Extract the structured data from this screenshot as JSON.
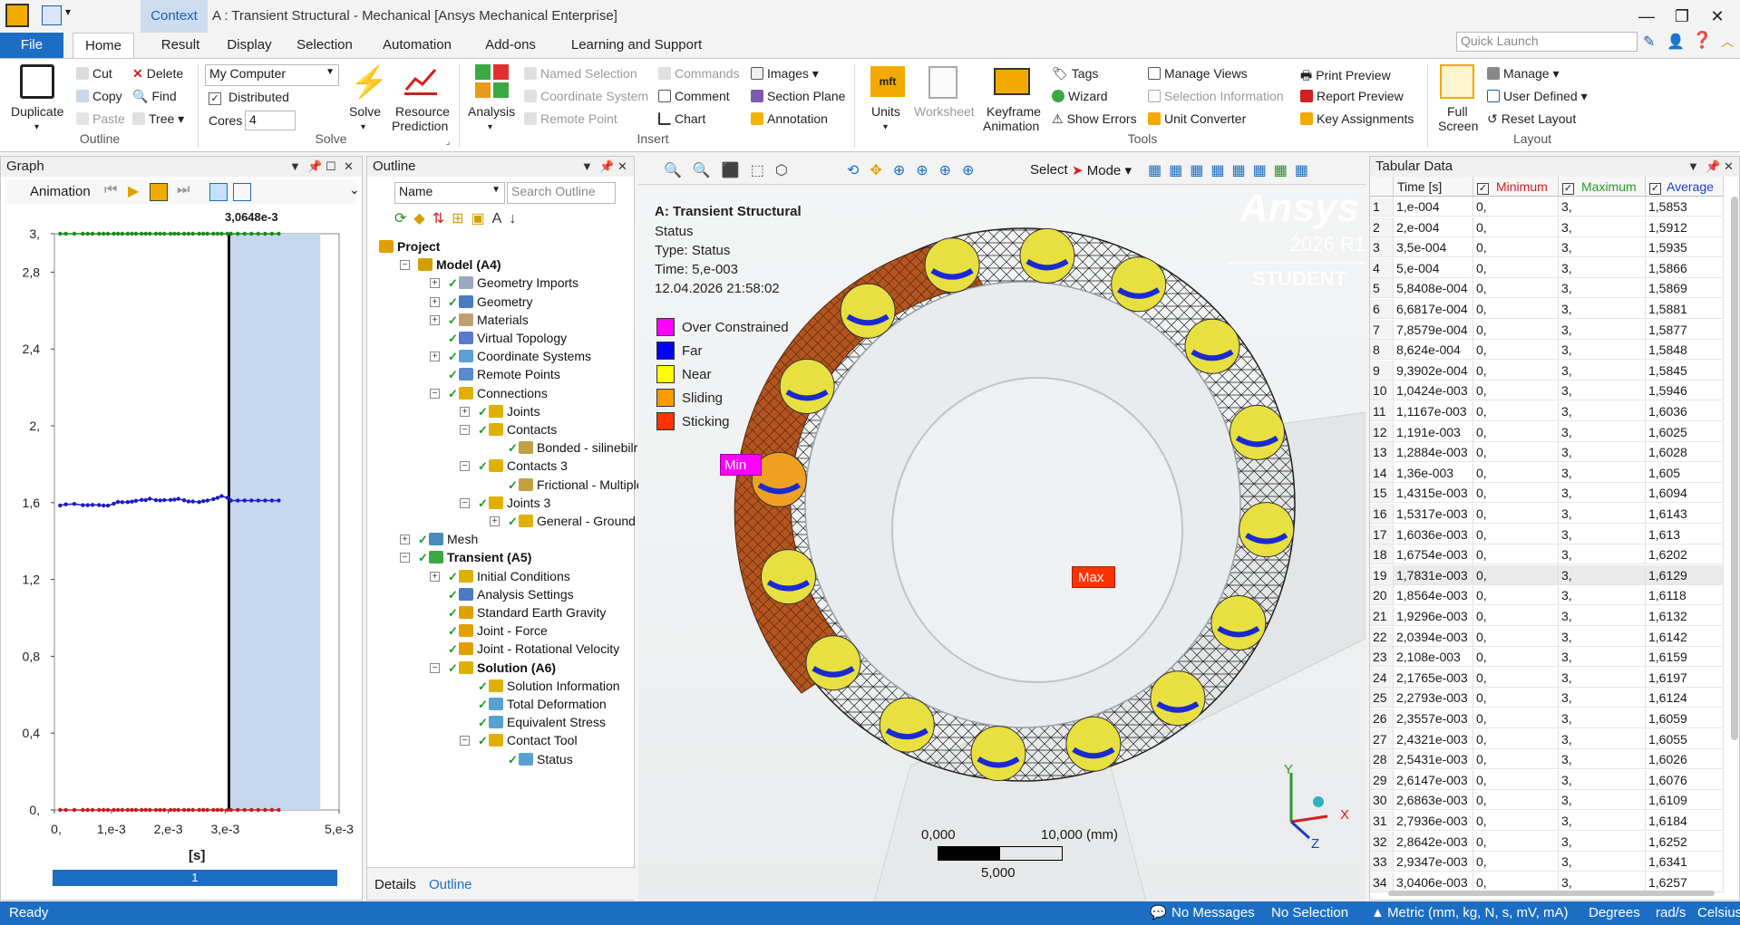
{
  "titlebar": {
    "context_tab": "Context",
    "title": "A : Transient Structural - Mechanical [Ansys Mechanical Enterprise]",
    "minimize": "—",
    "restore": "❐",
    "close": "✕"
  },
  "tabs": [
    "File",
    "Home",
    "Result",
    "Display",
    "Selection",
    "Automation",
    "Add-ons",
    "Learning and Support"
  ],
  "quick_launch_placeholder": "Quick Launch",
  "ribbon": {
    "duplicate": "Duplicate",
    "cut": "Cut",
    "copy": "Copy",
    "paste": "Paste",
    "delete": "Delete",
    "find": "Find",
    "tree": "Tree",
    "outline_group": "Outline",
    "solver_target": "My Computer",
    "distributed": "Distributed",
    "cores_label": "Cores",
    "cores_value": "4",
    "solve": "Solve",
    "resource_prediction_1": "Resource",
    "resource_prediction_2": "Prediction",
    "solve_group": "Solve",
    "analysis": "Analysis",
    "named_selection": "Named Selection",
    "coordinate_system": "Coordinate System",
    "remote_point": "Remote Point",
    "commands": "Commands",
    "comment": "Comment",
    "chart": "Chart",
    "images": "Images",
    "section_plane": "Section Plane",
    "annotation": "Annotation",
    "insert_group": "Insert",
    "units": "Units",
    "worksheet": "Worksheet",
    "keyframe_1": "Keyframe",
    "keyframe_2": "Animation",
    "tags": "Tags",
    "wizard": "Wizard",
    "show_errors": "Show Errors",
    "manage_views": "Manage Views",
    "selection_information": "Selection Information",
    "unit_converter": "Unit Converter",
    "print_preview": "Print Preview",
    "report_preview": "Report Preview",
    "key_assignments": "Key Assignments",
    "tools_group": "Tools",
    "full_screen_1": "Full",
    "full_screen_2": "Screen",
    "manage": "Manage",
    "user_defined": "User Defined",
    "reset_layout": "Reset Layout",
    "layout_group": "Layout"
  },
  "graph": {
    "title": "Graph",
    "animation": "Animation",
    "cursor_label": "3,0648e-3",
    "y_ticks": [
      "3,",
      "2,8",
      "2,4",
      "2,",
      "1,6",
      "1,2",
      "0,8",
      "0,4",
      "0,"
    ],
    "x_ticks": [
      "0,",
      "1,e-3",
      "2,e-3",
      "3,e-3",
      "5,e-3"
    ],
    "x_unit": "[s]",
    "frame": "1"
  },
  "outline": {
    "title": "Outline",
    "filter": "Name",
    "search_placeholder": "Search Outline",
    "items": [
      "Project",
      "Model (A4)",
      "Geometry Imports",
      "Geometry",
      "Materials",
      "Virtual Topology",
      "Coordinate Systems",
      "Remote Points",
      "Connections",
      "Joints",
      "Contacts",
      "Bonded - silinebilri ru",
      "Contacts 3",
      "Frictional - Multiple T",
      "Joints 3",
      "General - Ground To",
      "Mesh",
      "Transient (A5)",
      "Initial Conditions",
      "Analysis Settings",
      "Standard Earth Gravity",
      "Joint - Force",
      "Joint - Rotational Velocity",
      "Solution (A6)",
      "Solution Information",
      "Total Deformation",
      "Equivalent Stress",
      "Contact Tool",
      "Status"
    ],
    "bottom_tabs": [
      "Details",
      "Outline"
    ]
  },
  "viewport": {
    "select": "Select",
    "mode": "Mode",
    "info": [
      "A: Transient Structural",
      "Status",
      "Type: Status",
      "Time: 5,e-003",
      "12.04.2026 21:58:02"
    ],
    "legend": [
      {
        "label": "Over Constrained",
        "color": "#ff00ff"
      },
      {
        "label": "Far",
        "color": "#0000ff"
      },
      {
        "label": "Near",
        "color": "#ffff00"
      },
      {
        "label": "Sliding",
        "color": "#ff9900"
      },
      {
        "label": "Sticking",
        "color": "#ff3300"
      }
    ],
    "brand": "Ansys",
    "version": "2026 R1",
    "edition": "STUDENT",
    "min_tag": "Min",
    "max_tag": "Max",
    "scale_0": "0,000",
    "scale_10": "10,000 (mm)",
    "scale_5": "5,000",
    "axis_y": "Y",
    "axis_x": "X",
    "axis_z": "Z"
  },
  "tabular": {
    "title": "Tabular Data",
    "columns": [
      "Time [s]",
      "Minimum",
      "Maximum",
      "Average"
    ],
    "rows": [
      [
        "1",
        "1,e-004",
        "0,",
        "3,",
        "1,5853"
      ],
      [
        "2",
        "2,e-004",
        "0,",
        "3,",
        "1,5912"
      ],
      [
        "3",
        "3,5e-004",
        "0,",
        "3,",
        "1,5935"
      ],
      [
        "4",
        "5,e-004",
        "0,",
        "3,",
        "1,5866"
      ],
      [
        "5",
        "5,8408e-004",
        "0,",
        "3,",
        "1,5869"
      ],
      [
        "6",
        "6,6817e-004",
        "0,",
        "3,",
        "1,5881"
      ],
      [
        "7",
        "7,8579e-004",
        "0,",
        "3,",
        "1,5877"
      ],
      [
        "8",
        "8,624e-004",
        "0,",
        "3,",
        "1,5848"
      ],
      [
        "9",
        "9,3902e-004",
        "0,",
        "3,",
        "1,5845"
      ],
      [
        "10",
        "1,0424e-003",
        "0,",
        "3,",
        "1,5946"
      ],
      [
        "11",
        "1,1167e-003",
        "0,",
        "3,",
        "1,6036"
      ],
      [
        "12",
        "1,191e-003",
        "0,",
        "3,",
        "1,6025"
      ],
      [
        "13",
        "1,2884e-003",
        "0,",
        "3,",
        "1,6028"
      ],
      [
        "14",
        "1,36e-003",
        "0,",
        "3,",
        "1,605"
      ],
      [
        "15",
        "1,4315e-003",
        "0,",
        "3,",
        "1,6094"
      ],
      [
        "16",
        "1,5317e-003",
        "0,",
        "3,",
        "1,6143"
      ],
      [
        "17",
        "1,6036e-003",
        "0,",
        "3,",
        "1,613"
      ],
      [
        "18",
        "1,6754e-003",
        "0,",
        "3,",
        "1,6202"
      ],
      [
        "19",
        "1,7831e-003",
        "0,",
        "3,",
        "1,6129"
      ],
      [
        "20",
        "1,8564e-003",
        "0,",
        "3,",
        "1,6118"
      ],
      [
        "21",
        "1,9296e-003",
        "0,",
        "3,",
        "1,6132"
      ],
      [
        "22",
        "2,0394e-003",
        "0,",
        "3,",
        "1,6142"
      ],
      [
        "23",
        "2,108e-003",
        "0,",
        "3,",
        "1,6159"
      ],
      [
        "24",
        "2,1765e-003",
        "0,",
        "3,",
        "1,6197"
      ],
      [
        "25",
        "2,2793e-003",
        "0,",
        "3,",
        "1,6124"
      ],
      [
        "26",
        "2,3557e-003",
        "0,",
        "3,",
        "1,6059"
      ],
      [
        "27",
        "2,4321e-003",
        "0,",
        "3,",
        "1,6055"
      ],
      [
        "28",
        "2,5431e-003",
        "0,",
        "3,",
        "1,6026"
      ],
      [
        "29",
        "2,6147e-003",
        "0,",
        "3,",
        "1,6076"
      ],
      [
        "30",
        "2,6863e-003",
        "0,",
        "3,",
        "1,6109"
      ],
      [
        "31",
        "2,7936e-003",
        "0,",
        "3,",
        "1,6184"
      ],
      [
        "32",
        "2,8642e-003",
        "0,",
        "3,",
        "1,6252"
      ],
      [
        "33",
        "2,9347e-003",
        "0,",
        "3,",
        "1,6341"
      ],
      [
        "34",
        "3,0406e-003",
        "0,",
        "3,",
        "1,6257"
      ]
    ]
  },
  "statusbar": {
    "ready": "Ready",
    "messages": "No Messages",
    "selection": "No Selection",
    "units": "Metric (mm, kg, N, s, mV, mA)",
    "angle": "Degrees",
    "rate": "rad/s",
    "temp": "Celsius"
  },
  "chart_data": {
    "type": "line",
    "xlim": [
      0,
      0.005
    ],
    "ylim": [
      0,
      3
    ],
    "cursor_x": 0.0030648,
    "series": [
      {
        "name": "Maximum",
        "color": "#1a8a1a",
        "values": [
          3,
          3,
          3,
          3,
          3,
          3,
          3,
          3,
          3,
          3,
          3,
          3,
          3,
          3,
          3,
          3,
          3,
          3,
          3,
          3,
          3,
          3,
          3,
          3,
          3,
          3,
          3,
          3,
          3,
          3,
          3,
          3,
          3,
          3
        ]
      },
      {
        "name": "Average",
        "color": "#1a1ac8",
        "values": [
          1.5853,
          1.5912,
          1.5935,
          1.5866,
          1.5869,
          1.5881,
          1.5877,
          1.5848,
          1.5845,
          1.5946,
          1.6036,
          1.6025,
          1.6028,
          1.605,
          1.6094,
          1.6143,
          1.613,
          1.6202,
          1.6129,
          1.6118,
          1.6132,
          1.6142,
          1.6159,
          1.6197,
          1.6124,
          1.6059,
          1.6055,
          1.6026,
          1.6076,
          1.6109,
          1.6184,
          1.6252,
          1.6341,
          1.6257
        ]
      },
      {
        "name": "Minimum",
        "color": "#c81a1a",
        "values": [
          0,
          0,
          0,
          0,
          0,
          0,
          0,
          0,
          0,
          0,
          0,
          0,
          0,
          0,
          0,
          0,
          0,
          0,
          0,
          0,
          0,
          0,
          0,
          0,
          0,
          0,
          0,
          0,
          0,
          0,
          0,
          0,
          0,
          0
        ]
      }
    ],
    "x": [
      0.0001,
      0.0002,
      0.00035,
      0.0005,
      0.00058408,
      0.00066817,
      0.00078579,
      0.0008624,
      0.00093902,
      0.0010424,
      0.0011167,
      0.001191,
      0.0012884,
      0.00136,
      0.0014315,
      0.0015317,
      0.0016036,
      0.0016754,
      0.0017831,
      0.0018564,
      0.0019296,
      0.0020394,
      0.002108,
      0.0021765,
      0.0022793,
      0.0023557,
      0.0024321,
      0.0025431,
      0.0026147,
      0.0026863,
      0.0027936,
      0.0028642,
      0.0029347,
      0.0030406
    ]
  }
}
